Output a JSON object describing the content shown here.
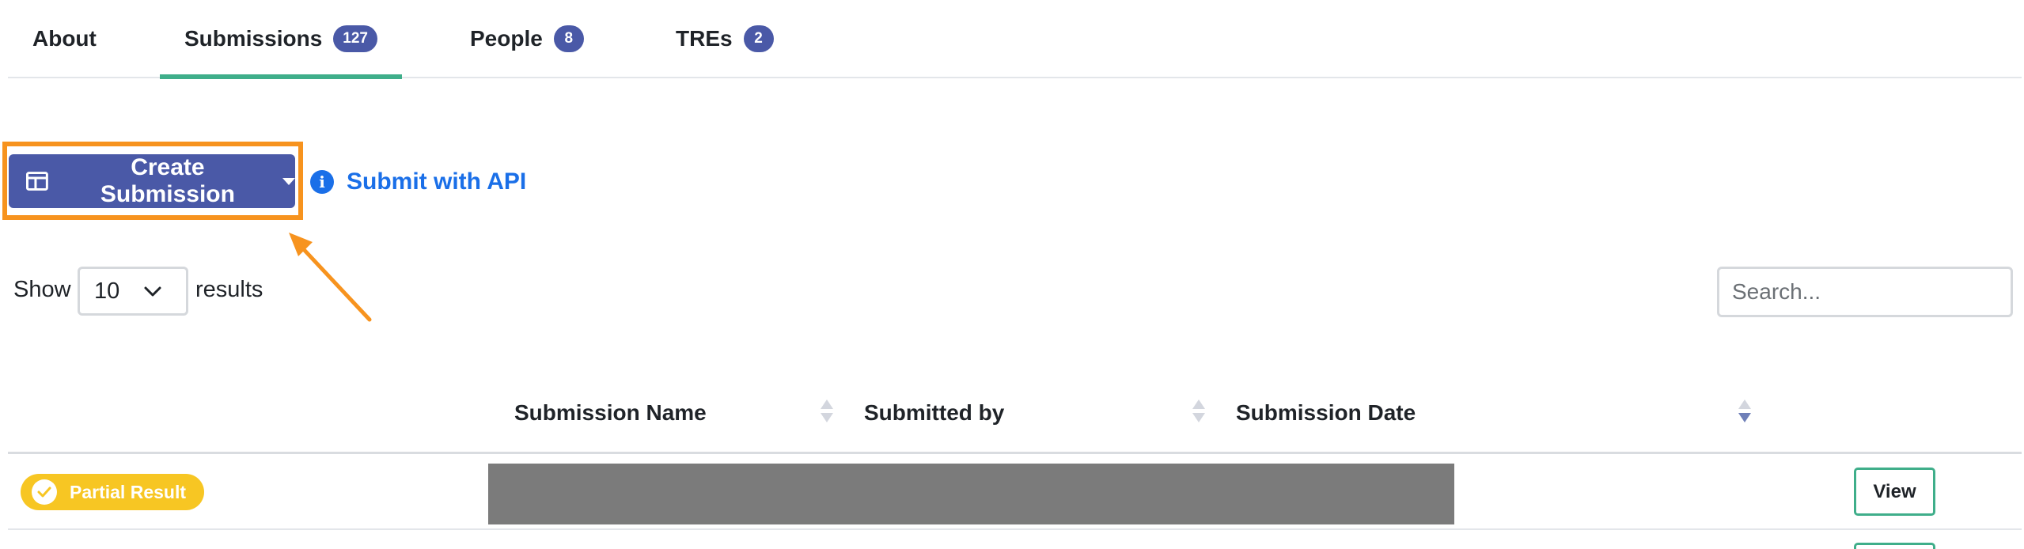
{
  "tabs": [
    {
      "label": "About",
      "badge": null
    },
    {
      "label": "Submissions",
      "badge": "127",
      "active": true
    },
    {
      "label": "People",
      "badge": "8"
    },
    {
      "label": "TREs",
      "badge": "2"
    }
  ],
  "actions": {
    "create_label": "Create Submission",
    "api_label": "Submit with API"
  },
  "paging": {
    "show_label": "Show",
    "page_size": "10",
    "results_label": "results",
    "search_placeholder": "Search..."
  },
  "table": {
    "columns": [
      "Submission Name",
      "Submitted by",
      "Submission Date"
    ],
    "rows": [
      {
        "status": "Partial Result",
        "action": "View"
      }
    ]
  },
  "colors": {
    "primary": "#4a59a7",
    "tab_underline": "#3fae8a",
    "highlight": "#f7931e",
    "link": "#1a6fe8",
    "status_partial": "#f7c623",
    "redaction": "#7b7b7b"
  }
}
